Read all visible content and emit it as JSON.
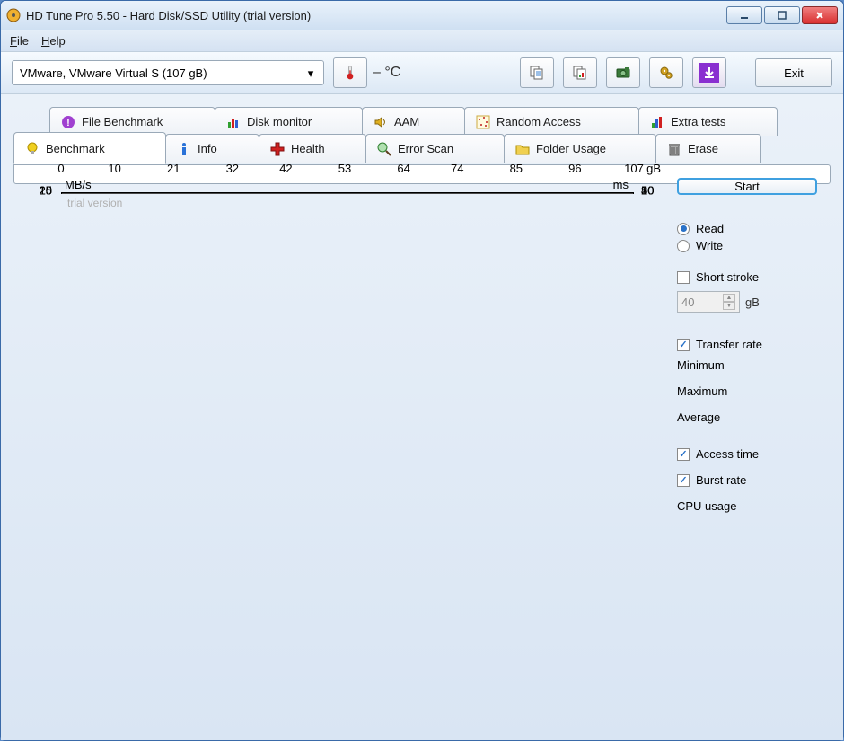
{
  "window": {
    "title": "HD Tune Pro 5.50 - Hard Disk/SSD Utility (trial version)"
  },
  "menu": {
    "file": "File",
    "help": "Help"
  },
  "toolbar": {
    "drive_selected": "VMware, VMware Virtual S (107 gB)",
    "temperature": "– °C",
    "exit_label": "Exit"
  },
  "tabs_back": [
    {
      "id": "file-benchmark",
      "label": "File Benchmark"
    },
    {
      "id": "disk-monitor",
      "label": "Disk monitor"
    },
    {
      "id": "aam",
      "label": "AAM"
    },
    {
      "id": "random-access",
      "label": "Random Access"
    },
    {
      "id": "extra-tests",
      "label": "Extra tests"
    }
  ],
  "tabs_front": [
    {
      "id": "benchmark",
      "label": "Benchmark"
    },
    {
      "id": "info",
      "label": "Info"
    },
    {
      "id": "health",
      "label": "Health"
    },
    {
      "id": "error-scan",
      "label": "Error Scan"
    },
    {
      "id": "folder-usage",
      "label": "Folder Usage"
    },
    {
      "id": "erase",
      "label": "Erase"
    }
  ],
  "chart": {
    "y_left_unit": "MB/s",
    "y_right_unit": "ms",
    "watermark": "trial version",
    "x_unit": "gB"
  },
  "chart_data": {
    "type": "line",
    "x_ticks": [
      0,
      10,
      21,
      32,
      42,
      53,
      64,
      74,
      85,
      96,
      107
    ],
    "y_left_ticks": [
      5,
      10,
      15,
      20,
      25
    ],
    "y_right_ticks": [
      10,
      20,
      30,
      40,
      50
    ],
    "x_range": [
      0,
      107
    ],
    "y_left_range": [
      0,
      25
    ],
    "y_right_range": [
      0,
      50
    ],
    "xlabel": "gB",
    "y_left_label": "MB/s",
    "y_right_label": "ms",
    "series": []
  },
  "side": {
    "start": "Start",
    "read": "Read",
    "write": "Write",
    "short_stroke": "Short stroke",
    "short_stroke_value": "40",
    "short_stroke_unit": "gB",
    "transfer_rate": "Transfer rate",
    "minimum": "Minimum",
    "maximum": "Maximum",
    "average": "Average",
    "access_time": "Access time",
    "burst_rate": "Burst rate",
    "cpu_usage": "CPU usage"
  }
}
